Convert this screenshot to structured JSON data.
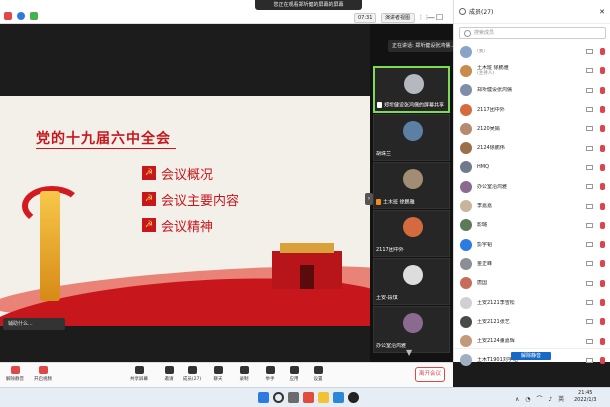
{
  "topbar": {
    "share_banner": "您正在观看郑圻健的屏幕的屏幕",
    "time": "07:31",
    "view_label": "演讲者视图",
    "pin_symbol": "⋮⋮",
    "minimize": "—",
    "maximize": "☐",
    "close": "✕"
  },
  "slide": {
    "title": "党的十九届六中全会",
    "bullets": [
      "会议概况",
      "会议主要内容",
      "会议精神"
    ],
    "flag_glyph": "☭"
  },
  "speaker_tag": "辅助什么...",
  "speaking_banner": "正在讲话: 郑圻健设张鸿儒...",
  "video_tiles": [
    {
      "label": "郑圻健设张鸿儒的屏幕共享",
      "active": true
    },
    {
      "label": "胡珠兰",
      "active": false
    },
    {
      "label": "土木班 徐鹏雅",
      "active": false
    },
    {
      "label": "2117团中外",
      "active": false
    },
    {
      "label": "土安-段琪",
      "active": false
    },
    {
      "label": "办公室沿鸿雅",
      "active": false
    }
  ],
  "panel": {
    "title": "成员(27)",
    "search_placeholder": "搜索成员",
    "mute_all": "解除静音",
    "participants": [
      {
        "name": "",
        "sub": "(我)",
        "color": "#8aa4c8"
      },
      {
        "name": "土木班 徐鹏雅",
        "sub": "(主持人)",
        "color": "#c98a4b"
      },
      {
        "name": "郑圻健设张鸿儒",
        "sub": "",
        "color": "#7e8ea8"
      },
      {
        "name": "2117团中外",
        "sub": "",
        "color": "#d66a3f"
      },
      {
        "name": "2120吴娟",
        "sub": "",
        "color": "#b58a6e"
      },
      {
        "name": "2124徐鹏伟",
        "sub": "",
        "color": "#9a6f4a"
      },
      {
        "name": "HMQ",
        "sub": "",
        "color": "#6f7a8c"
      },
      {
        "name": "办公室沿鸿雅",
        "sub": "",
        "color": "#8a6a8e"
      },
      {
        "name": "李嘉嘉",
        "sub": "",
        "color": "#c7b49a"
      },
      {
        "name": "影璐",
        "sub": "",
        "color": "#5a7a5a"
      },
      {
        "name": "彭宇韬",
        "sub": "",
        "color": "#2d7be0"
      },
      {
        "name": "金正峰",
        "sub": "",
        "color": "#8a8f96"
      },
      {
        "name": "唐国",
        "sub": "",
        "color": "#c76b5a"
      },
      {
        "name": "土安2121李雪松",
        "sub": "",
        "color": "#d0d0d0"
      },
      {
        "name": "土安2121张艺",
        "sub": "",
        "color": "#4a4a4a"
      },
      {
        "name": "土安2124董嘉辉",
        "sub": "",
        "color": "#c29a7a"
      },
      {
        "name": "土木T1901刘宇韬",
        "sub": "",
        "color": "#9fb0c2"
      }
    ]
  },
  "toolbar": {
    "buttons": [
      {
        "label": "解除静音",
        "name": "unmute-button"
      },
      {
        "label": "开启视频",
        "name": "start-video-button"
      },
      {
        "label": "共享屏幕",
        "name": "share-screen-button"
      },
      {
        "label": "邀请",
        "name": "invite-button"
      },
      {
        "label": "成员(27)",
        "name": "participants-button"
      },
      {
        "label": "聊天",
        "name": "chat-button"
      },
      {
        "label": "录制",
        "name": "record-button"
      },
      {
        "label": "举手",
        "name": "raise-hand-button"
      },
      {
        "label": "应用",
        "name": "apps-button"
      },
      {
        "label": "设置",
        "name": "settings-button"
      }
    ],
    "leave": "离开会议"
  },
  "taskbar": {
    "time": "21:45",
    "date": "2022/1/3",
    "tray": "∧ ◔ ⌒ ♪ 英"
  },
  "colors": {
    "accent_red": "#c8161d",
    "active_green": "#7cdc54",
    "brand_blue": "#1769c7"
  }
}
